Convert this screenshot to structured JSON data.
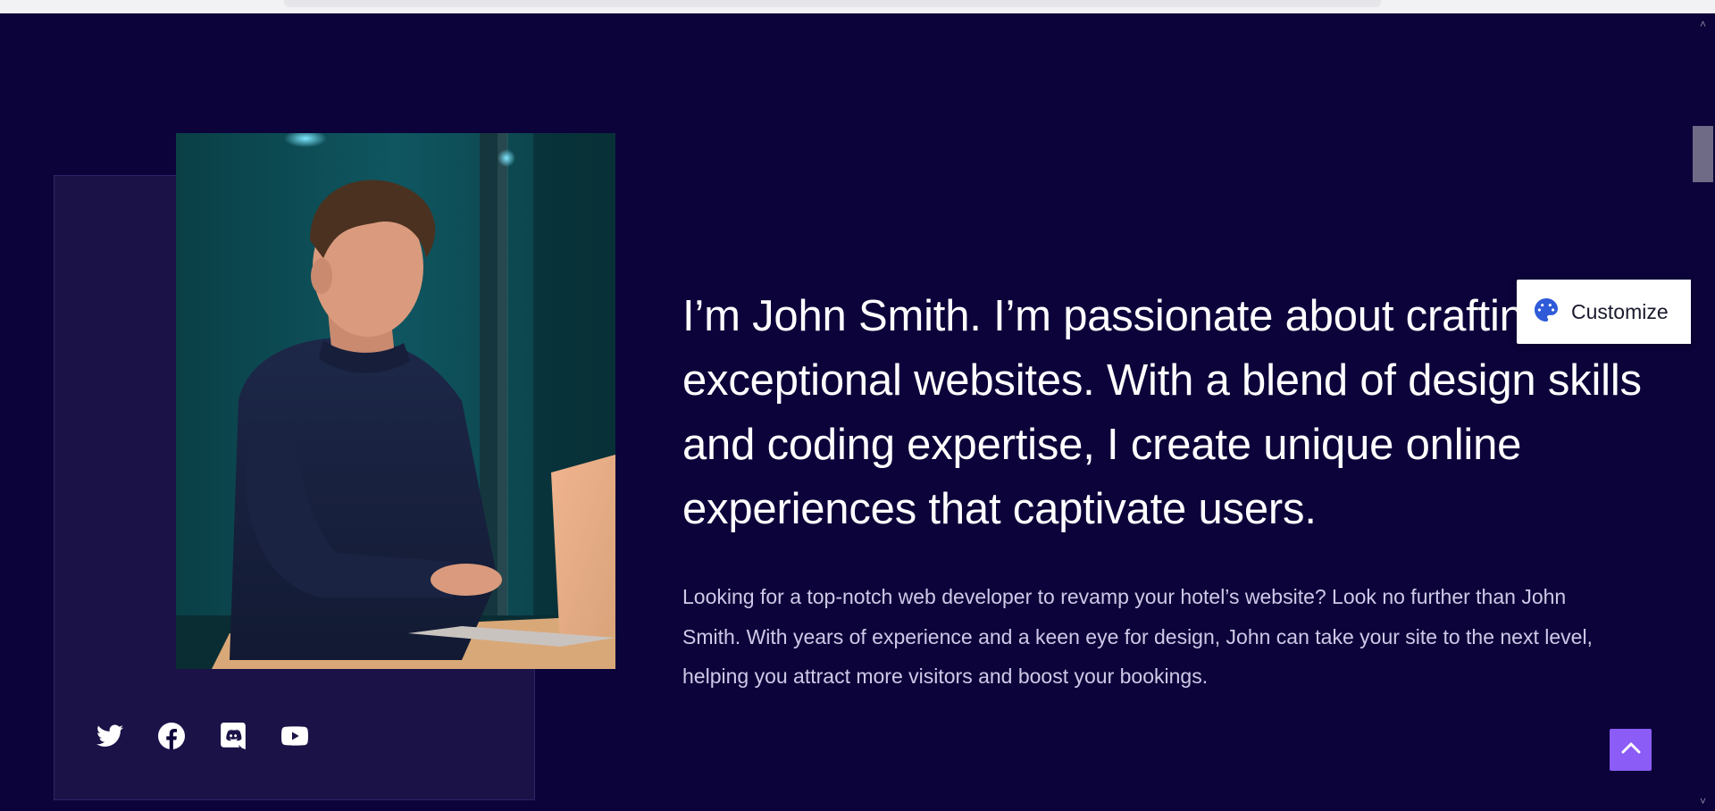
{
  "hero": {
    "heading": "I’m John Smith. I’m passionate about crafting exceptional websites. With a blend of design skills and coding expertise, I create unique online experiences that captivate users.",
    "paragraph": "Looking for a top-notch web developer to revamp your hotel’s website? Look no further than John Smith. With years of experience and a keen eye for design, John can take your site to the next level, helping you attract more visitors and boost your bookings."
  },
  "photo": {
    "subject": "man-working-on-laptop"
  },
  "socials": [
    {
      "name": "twitter-icon"
    },
    {
      "name": "facebook-icon"
    },
    {
      "name": "discord-icon"
    },
    {
      "name": "youtube-icon"
    }
  ],
  "customize": {
    "label": "Customize",
    "icon": "palette-icon",
    "icon_color": "#2f5bd8"
  },
  "to_top": {
    "icon": "chevron-up-icon",
    "color": "#8b5cf6"
  },
  "colors": {
    "background": "#0c033a",
    "card": "#1b1248",
    "heading": "#ffffff",
    "paragraph": "#cfc9e8"
  }
}
